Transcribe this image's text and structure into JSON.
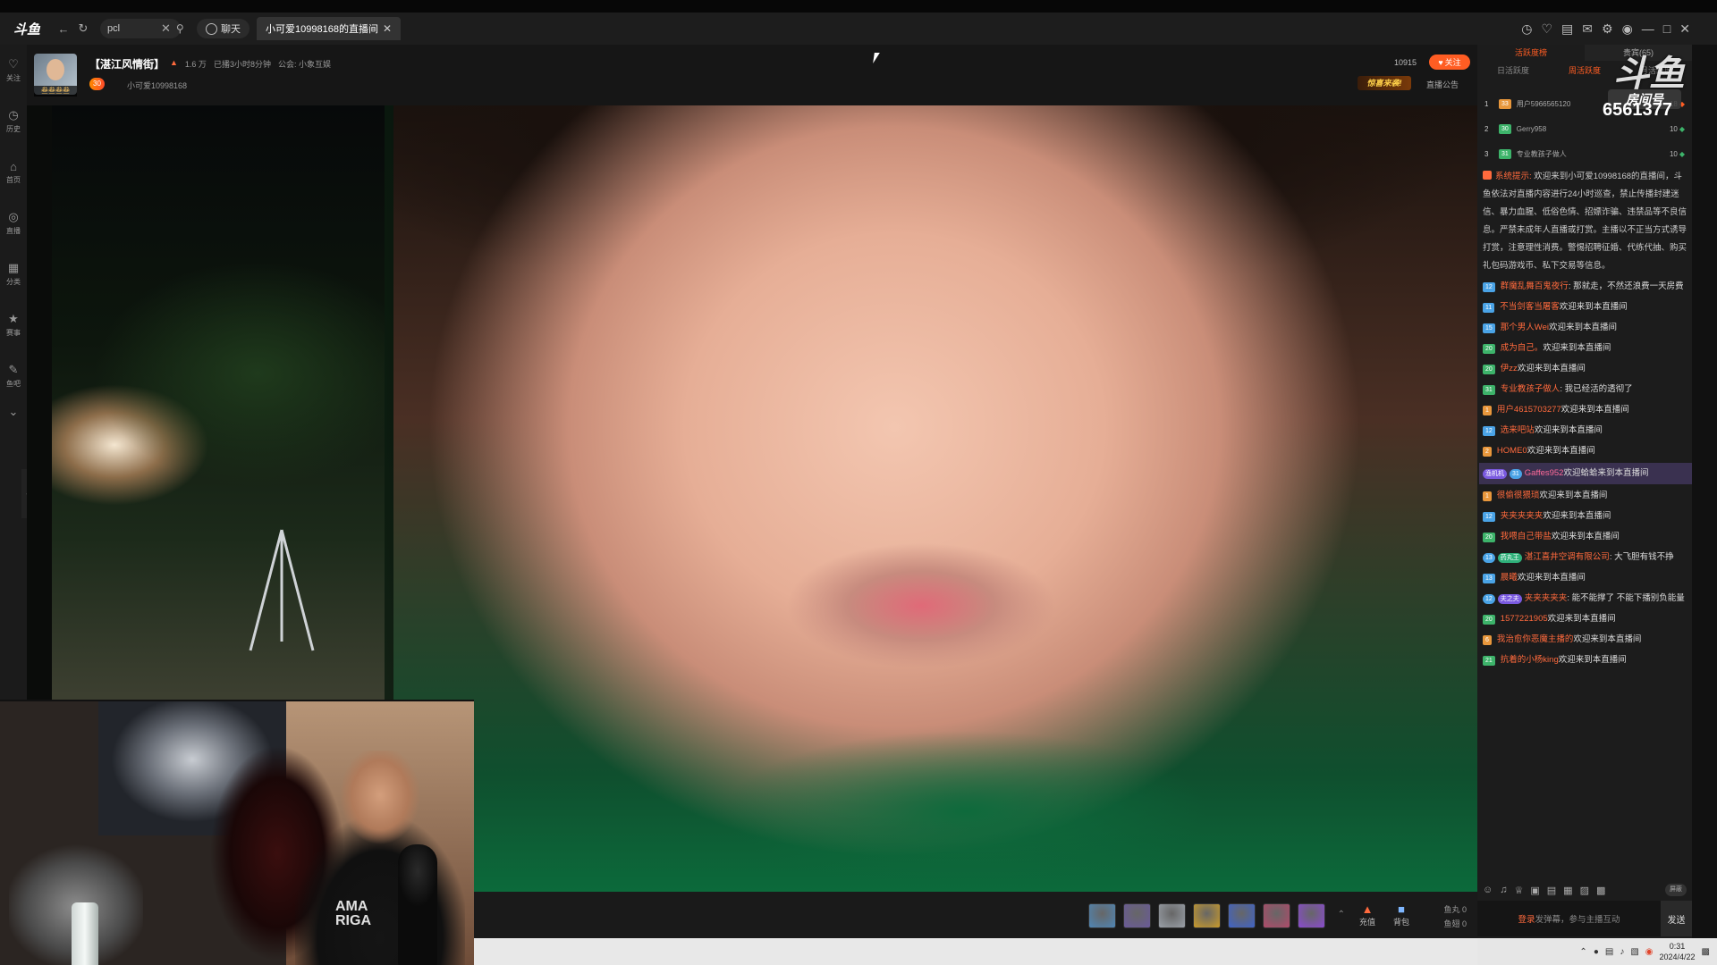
{
  "app": {
    "logo": "斗鱼"
  },
  "tabbar": {
    "search_value": "pcl",
    "chat_label": "聊天",
    "tab_label": "小可爱10998168的直播间"
  },
  "sidebar": {
    "items": [
      {
        "icon": "heart-icon",
        "label": "关注"
      },
      {
        "icon": "clock-icon",
        "label": "历史"
      },
      {
        "icon": "home-icon",
        "label": "首页"
      },
      {
        "icon": "live-icon",
        "label": "直播"
      },
      {
        "icon": "grid-icon",
        "label": "分类"
      },
      {
        "icon": "trophy-icon",
        "label": "赛事"
      },
      {
        "icon": "fish-icon",
        "label": "鱼吧"
      }
    ]
  },
  "room": {
    "avatar_tag": "叁叁叁叁",
    "title": "【湛江风情街】",
    "hot": "1.6 万",
    "duration": "已播3小时8分钟",
    "guild": "公会: 小象互娱",
    "level": "30",
    "anchor": "小可爱10998168",
    "count": "10915",
    "follow_label": "关注",
    "promo": "惊喜来袭!",
    "notice": "直播公告"
  },
  "pip": {
    "shirt_text": "AMA\nRIGA"
  },
  "rank": {
    "tabs": [
      "活跃度榜",
      "贵宾(65)"
    ],
    "subtabs": [
      "日活跃度",
      "周活跃度",
      "月活跃度"
    ],
    "rows": [
      {
        "n": "1",
        "lv": "33",
        "name": "用户5966565120",
        "score": "18",
        "up": true
      },
      {
        "n": "2",
        "lv": "30",
        "name": "Gerry958",
        "score": "10",
        "up": false
      },
      {
        "n": "3",
        "lv": "31",
        "name": "专业教孩子做人",
        "score": "10",
        "up": false
      }
    ]
  },
  "watermark": {
    "logo": "斗鱼",
    "room_label": "房间号",
    "room_no": "6561377"
  },
  "chat": {
    "system_label": "系统提示:",
    "system_text": "欢迎来到小可爱10998168的直播间，斗鱼依法对直播内容进行24小时巡查，禁止传播封建迷信、暴力血腥、低俗色情、招嫖诈骗、违禁品等不良信息。严禁未成年人直播或打赏。主播以不正当方式诱导打赏，注意理性消费。警惕招聘征婚、代练代抽、购买礼包码游戏币、私下交易等信息。",
    "messages": [
      {
        "lv": "12",
        "lvc": "blue",
        "user": "群魔乱舞百鬼夜行",
        "text": ": 那就走，不然还浪费一天房费"
      },
      {
        "lv": "11",
        "lvc": "blue",
        "user": "不当剑客当屠客",
        "text": "欢迎来到本直播间"
      },
      {
        "lv": "15",
        "lvc": "blue",
        "user": "那个男人Wei",
        "text": "欢迎来到本直播间"
      },
      {
        "lv": "20",
        "lvc": "green",
        "user": "成为自己。",
        "text": "欢迎来到本直播间"
      },
      {
        "lv": "20",
        "lvc": "green",
        "user": "伊zz",
        "text": "欢迎来到本直播间"
      },
      {
        "lv": "31",
        "lvc": "green",
        "user": "专业教孩子做人",
        "text": ": 我已经活的透彻了"
      },
      {
        "lv": "1",
        "lvc": "orange",
        "user": "用户4615703277",
        "text": "欢迎来到本直播间"
      },
      {
        "lv": "12",
        "lvc": "blue",
        "user": "选来吧站",
        "text": "欢迎来到本直播间"
      },
      {
        "lv": "2",
        "lvc": "orange",
        "user": "HOME0",
        "text": "欢迎来到本直播间"
      }
    ],
    "highlight": {
      "fan": "渔机机",
      "lv": "31",
      "user": "Gaffes952",
      "text": "欢迎蛤蛤来到本直播间"
    },
    "messages2": [
      {
        "lv": "1",
        "lvc": "orange",
        "user": "很偷很猥琐",
        "text": "欢迎来到本直播间"
      },
      {
        "lv": "12",
        "lvc": "blue",
        "user": "夹夹夹夹夹",
        "text": "欢迎来到本直播间"
      },
      {
        "lv": "20",
        "lvc": "green",
        "user": "我喂自己带盐",
        "text": "欢迎来到本直播间"
      }
    ],
    "fan_message": {
      "lv": "13",
      "fan": "药丸王",
      "user": "湛江喜井空调有限公司",
      "text": ": 大飞胆有钱不挣"
    },
    "messages3": [
      {
        "lv": "13",
        "lvc": "blue",
        "user": "晨曦",
        "text": "欢迎来到本直播间"
      }
    ],
    "fan_message2": {
      "lv": "12",
      "fan": "夫之夫",
      "user": "夹夹夹夹夹",
      "text": ": 能不能撑了 不能下播别负能量"
    },
    "messages4": [
      {
        "lv": "20",
        "lvc": "green",
        "user": "1577221905",
        "text": "欢迎来到本直播间"
      },
      {
        "lv": "6",
        "lvc": "orange",
        "user": "我治愈你恶魔主播的",
        "text": "欢迎来到本直播间"
      },
      {
        "lv": "21",
        "lvc": "green",
        "user": "抗着的小杨king",
        "text": "欢迎来到本直播间"
      }
    ],
    "shield_label": "屏蔽",
    "input_login": "登录",
    "input_text": "发弹幕，参与主播互动",
    "send_label": "发送"
  },
  "giftbar": {
    "gift_colors": [
      "#4f86b5",
      "#6a5a9a",
      "#9aa0a8",
      "#c99a2a",
      "#3f63c8",
      "#b04a6a",
      "#8a4ad0"
    ],
    "recharge": "充值",
    "backpack": "背包",
    "fish_balls": "鱼丸  0",
    "fish_wings": "鱼翅  0"
  },
  "taskbar": {
    "time": "0:31",
    "date": "2024/4/22"
  }
}
